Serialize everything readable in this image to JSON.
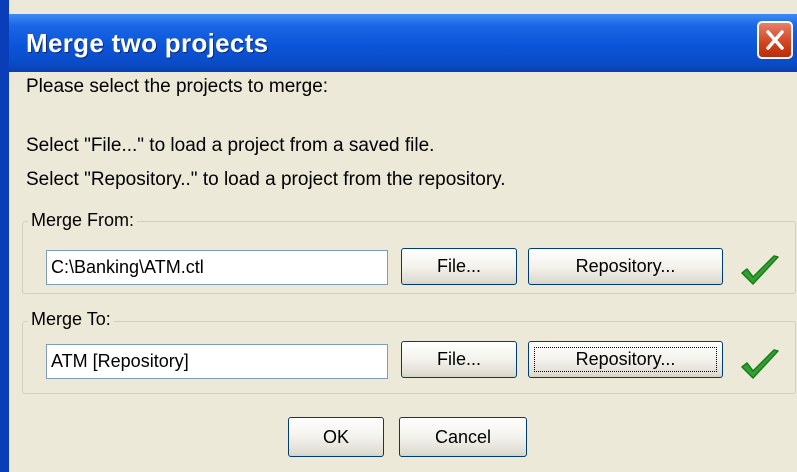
{
  "title": "Merge two projects",
  "instructions": {
    "line1": "Please select the projects to merge:",
    "line2": "Select \"File...\" to load a project from a saved file.",
    "line3": "Select \"Repository..\" to load a project from the repository."
  },
  "merge_from": {
    "label": "Merge From:",
    "value": "C:\\Banking\\ATM.ctl",
    "file_button": "File...",
    "repository_button": "Repository...",
    "status_icon": "green-checkmark"
  },
  "merge_to": {
    "label": "Merge To:",
    "value": "ATM [Repository]",
    "file_button": "File...",
    "repository_button": "Repository...",
    "status_icon": "green-checkmark"
  },
  "buttons": {
    "ok": "OK",
    "cancel": "Cancel"
  },
  "colors": {
    "titlebar": "#0a55d8",
    "close": "#d1421c",
    "check": "#2fa12f",
    "background": "#ece9d8"
  }
}
